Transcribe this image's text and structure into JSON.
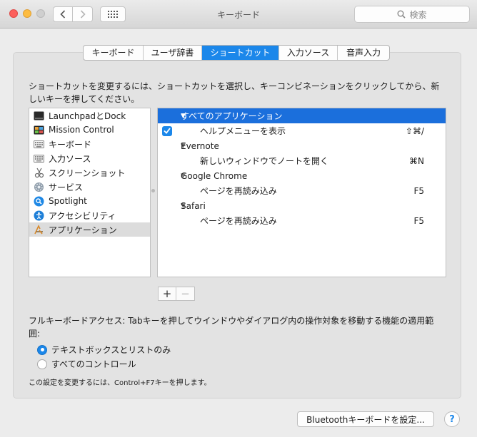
{
  "window": {
    "title": "キーボード"
  },
  "search": {
    "placeholder": "検索"
  },
  "tabs": [
    {
      "label": "キーボード",
      "active": false
    },
    {
      "label": "ユーザ辞書",
      "active": false
    },
    {
      "label": "ショートカット",
      "active": true
    },
    {
      "label": "入力ソース",
      "active": false
    },
    {
      "label": "音声入力",
      "active": false
    }
  ],
  "instruction": "ショートカットを変更するには、ショートカットを選択し、キーコンビネーションをクリックしてから、新しいキーを押してください。",
  "categories": [
    {
      "label": "LaunchpadとDock",
      "icon": "launchpad-icon"
    },
    {
      "label": "Mission Control",
      "icon": "mission-control-icon"
    },
    {
      "label": "キーボード",
      "icon": "keyboard-icon"
    },
    {
      "label": "入力ソース",
      "icon": "input-source-icon"
    },
    {
      "label": "スクリーンショット",
      "icon": "screenshot-icon"
    },
    {
      "label": "サービス",
      "icon": "gear-icon"
    },
    {
      "label": "Spotlight",
      "icon": "spotlight-icon"
    },
    {
      "label": "アクセシビリティ",
      "icon": "accessibility-icon"
    },
    {
      "label": "アプリケーション",
      "icon": "app-store-icon",
      "selected": true
    }
  ],
  "shortcuts": {
    "group_all": "すべてのアプリケーション",
    "help_menu": "ヘルプメニューを表示",
    "help_keys": "⇧⌘/",
    "evernote": "Evernote",
    "evernote_item": "新しいウィンドウでノートを開く",
    "evernote_keys": "⌘N",
    "chrome": "Google Chrome",
    "chrome_item": "ページを再読み込み",
    "chrome_keys": "F5",
    "safari": "Safari",
    "safari_item": "ページを再読み込み",
    "safari_keys": "F5"
  },
  "buttons": {
    "plus": "+",
    "minus": "−",
    "bluetooth": "Bluetoothキーボードを設定...",
    "help": "?"
  },
  "full_keyboard_access": {
    "label": "フルキーボードアクセス: Tabキーを押してウインドウやダイアログ内の操作対象を移動する機能の適用範囲:",
    "option_text_lists": "テキストボックスとリストのみ",
    "option_all_controls": "すべてのコントロール",
    "selected": "テキストボックスとリストのみ",
    "note": "この設定を変更するには、Control+F7キーを押します。"
  },
  "colors": {
    "accent": "#1b87ea",
    "selection": "#1b6fdc"
  }
}
